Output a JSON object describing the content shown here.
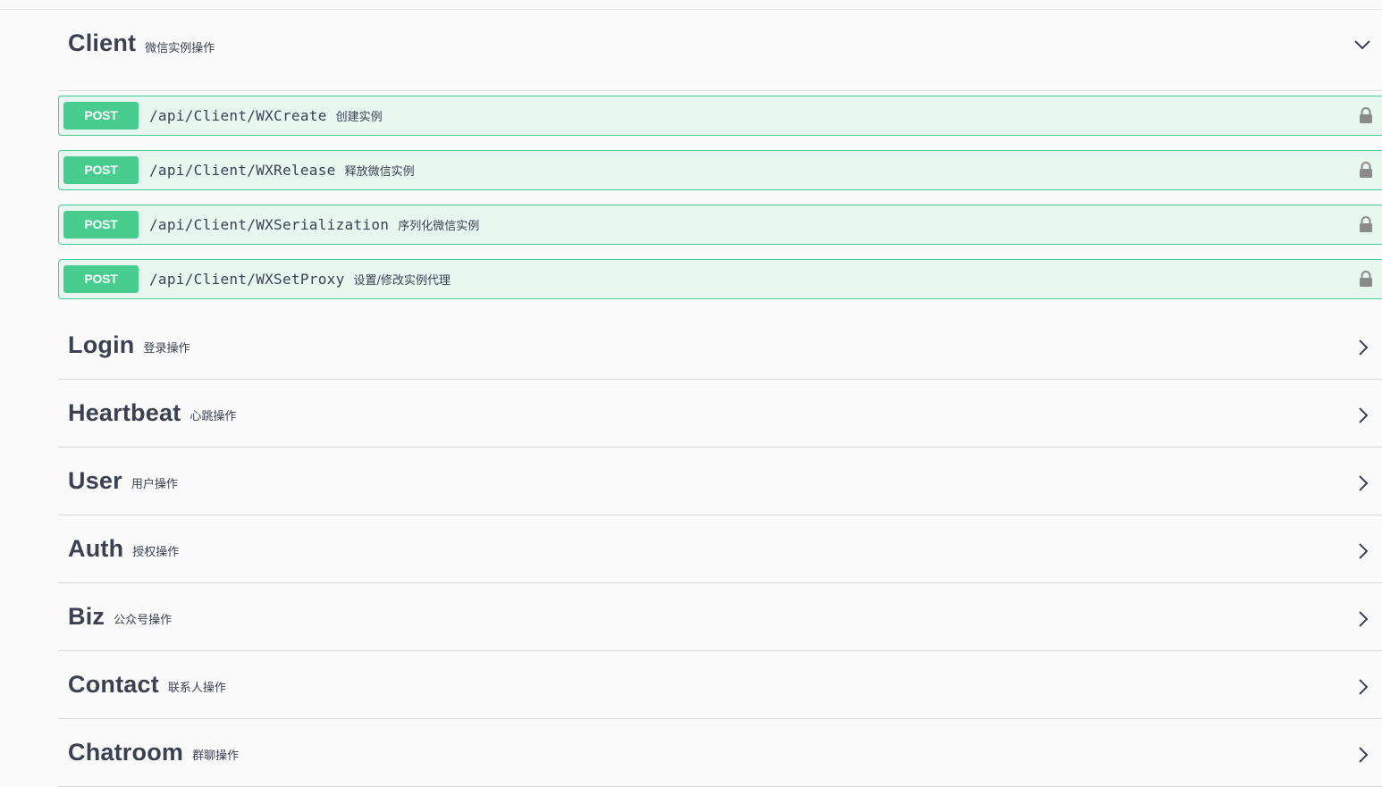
{
  "sections": [
    {
      "name": "Client",
      "desc": "微信实例操作",
      "expanded": true,
      "operations": [
        {
          "method": "POST",
          "path": "/api/Client/WXCreate",
          "summary": "创建实例"
        },
        {
          "method": "POST",
          "path": "/api/Client/WXRelease",
          "summary": "释放微信实例"
        },
        {
          "method": "POST",
          "path": "/api/Client/WXSerialization",
          "summary": "序列化微信实例"
        },
        {
          "method": "POST",
          "path": "/api/Client/WXSetProxy",
          "summary": "设置/修改实例代理"
        }
      ]
    },
    {
      "name": "Login",
      "desc": "登录操作",
      "expanded": false
    },
    {
      "name": "Heartbeat",
      "desc": "心跳操作",
      "expanded": false
    },
    {
      "name": "User",
      "desc": "用户操作",
      "expanded": false
    },
    {
      "name": "Auth",
      "desc": "授权操作",
      "expanded": false
    },
    {
      "name": "Biz",
      "desc": "公众号操作",
      "expanded": false
    },
    {
      "name": "Contact",
      "desc": "联系人操作",
      "expanded": false
    },
    {
      "name": "Chatroom",
      "desc": "群聊操作",
      "expanded": false
    }
  ],
  "colors": {
    "post_method": "#49cc90",
    "post_background": "#e8f6f0",
    "text": "#3b4151",
    "lock": "#8a8a8a"
  },
  "icons": {
    "expanded": "chevron-down-icon",
    "collapsed": "chevron-right-icon",
    "auth": "lock-icon"
  }
}
